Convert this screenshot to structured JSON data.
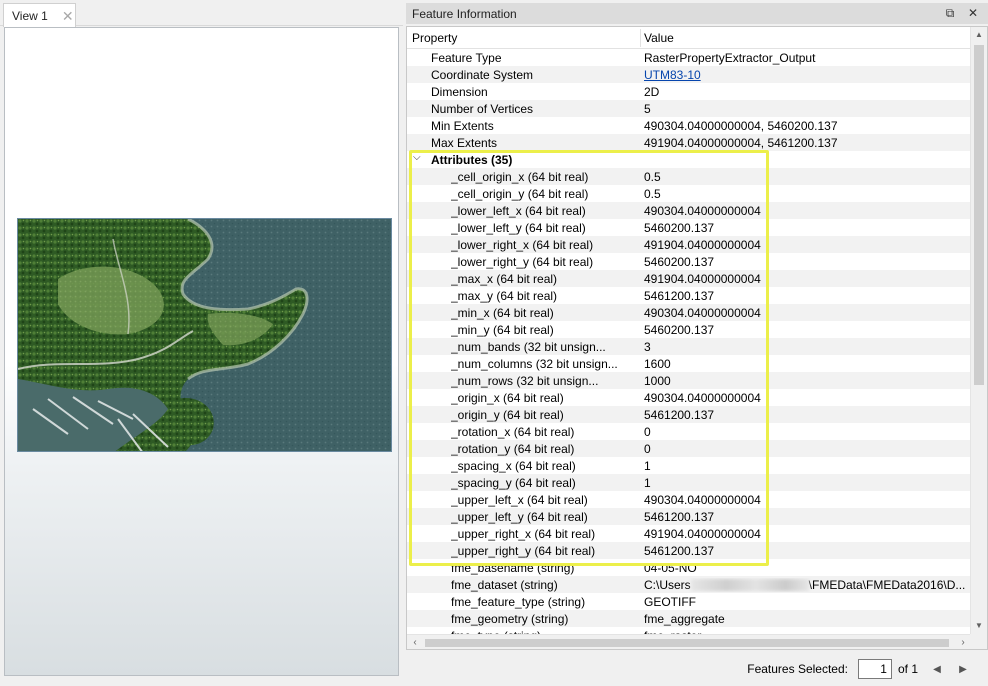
{
  "view_panel": {
    "tab_label": "View 1",
    "tab_close": "✕"
  },
  "info_panel": {
    "title": "Feature Information",
    "header_buttons": [
      "⧉",
      "✕"
    ],
    "columns": {
      "property": "Property",
      "value": "Value"
    },
    "rows": [
      {
        "type": "prop",
        "property": "Feature Type",
        "value": "RasterPropertyExtractor_Output"
      },
      {
        "type": "prop",
        "property": "Coordinate System",
        "value": "UTM83-10",
        "link": true
      },
      {
        "type": "prop",
        "property": "Dimension",
        "value": "2D"
      },
      {
        "type": "prop",
        "property": "Number of Vertices",
        "value": "5"
      },
      {
        "type": "prop",
        "property": "Min Extents",
        "value": "490304.04000000004, 5460200.137"
      },
      {
        "type": "prop",
        "property": "Max Extents",
        "value": "491904.04000000004, 5461200.137"
      },
      {
        "type": "group",
        "property": "Attributes (35)",
        "value": ""
      },
      {
        "type": "child",
        "property": "_cell_origin_x (64 bit real)",
        "value": "0.5"
      },
      {
        "type": "child",
        "property": "_cell_origin_y (64 bit real)",
        "value": "0.5"
      },
      {
        "type": "child",
        "property": "_lower_left_x (64 bit real)",
        "value": "490304.04000000004"
      },
      {
        "type": "child",
        "property": "_lower_left_y (64 bit real)",
        "value": "5460200.137"
      },
      {
        "type": "child",
        "property": "_lower_right_x (64 bit real)",
        "value": "491904.04000000004"
      },
      {
        "type": "child",
        "property": "_lower_right_y (64 bit real)",
        "value": "5460200.137"
      },
      {
        "type": "child",
        "property": "_max_x (64 bit real)",
        "value": "491904.04000000004"
      },
      {
        "type": "child",
        "property": "_max_y (64 bit real)",
        "value": "5461200.137"
      },
      {
        "type": "child",
        "property": "_min_x (64 bit real)",
        "value": "490304.04000000004"
      },
      {
        "type": "child",
        "property": "_min_y (64 bit real)",
        "value": "5460200.137"
      },
      {
        "type": "child",
        "property": "_num_bands (32 bit unsign...",
        "value": "3"
      },
      {
        "type": "child",
        "property": "_num_columns (32 bit unsign...",
        "value": "1600"
      },
      {
        "type": "child",
        "property": "_num_rows (32 bit unsign...",
        "value": "1000"
      },
      {
        "type": "child",
        "property": "_origin_x (64 bit real)",
        "value": "490304.04000000004"
      },
      {
        "type": "child",
        "property": "_origin_y (64 bit real)",
        "value": "5461200.137"
      },
      {
        "type": "child",
        "property": "_rotation_x (64 bit real)",
        "value": "0"
      },
      {
        "type": "child",
        "property": "_rotation_y (64 bit real)",
        "value": "0"
      },
      {
        "type": "child",
        "property": "_spacing_x (64 bit real)",
        "value": "1"
      },
      {
        "type": "child",
        "property": "_spacing_y (64 bit real)",
        "value": "1"
      },
      {
        "type": "child",
        "property": "_upper_left_x (64 bit real)",
        "value": "490304.04000000004"
      },
      {
        "type": "child",
        "property": "_upper_left_y (64 bit real)",
        "value": "5461200.137"
      },
      {
        "type": "child",
        "property": "_upper_right_x (64 bit real)",
        "value": "491904.04000000004"
      },
      {
        "type": "child",
        "property": "_upper_right_y (64 bit real)",
        "value": "5461200.137"
      },
      {
        "type": "child",
        "property": "fme_basename (string)",
        "value": "04-05-NO"
      },
      {
        "type": "child",
        "property": "fme_dataset (string)",
        "value": "C:\\Users",
        "value_suffix": "\\FMEData\\FMEData2016\\D...",
        "blurred": true
      },
      {
        "type": "child",
        "property": "fme_feature_type (string)",
        "value": "GEOTIFF"
      },
      {
        "type": "child",
        "property": "fme_geometry (string)",
        "value": "fme_aggregate"
      },
      {
        "type": "child",
        "property": "fme_type (string)",
        "value": "fme_raster"
      }
    ],
    "footer": {
      "features_selected_label": "Features Selected:",
      "page_value": "1",
      "page_total_label": "of 1"
    },
    "colors": {
      "highlight": "#ecef4a",
      "link": "#0645ad",
      "alt_row": "#f2f2f2"
    }
  }
}
